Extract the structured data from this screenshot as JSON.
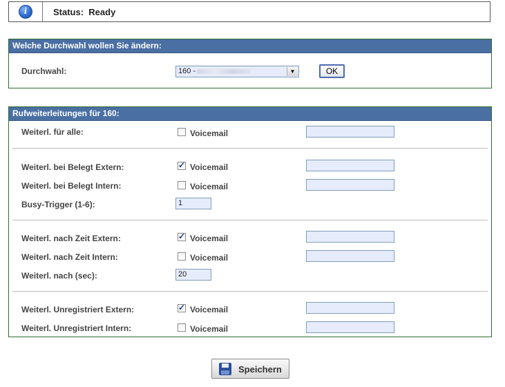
{
  "status": {
    "icon": "info-icon",
    "icon_glyph": "i",
    "label": "Status:",
    "value": "Ready"
  },
  "extension_panel": {
    "title": "Welche Durchwahl wollen Sie ändern:",
    "field_label": "Durchwahl:",
    "select_value": "160 -",
    "ok_label": "OK"
  },
  "forwarding_panel": {
    "title": "Rufweiterleitungen für 160:",
    "voicemail_label": "Voicemail",
    "rows": [
      {
        "label": "Weiterl. für alle:",
        "voicemail_checked": false,
        "target": ""
      },
      {
        "label": "Weiterl. bei Belegt Extern:",
        "voicemail_checked": true,
        "target": ""
      },
      {
        "label": "Weiterl. bei Belegt Intern:",
        "voicemail_checked": false,
        "target": ""
      },
      {
        "label": "Weiterl. nach Zeit Extern:",
        "voicemail_checked": true,
        "target": ""
      },
      {
        "label": "Weiterl. nach Zeit Intern:",
        "voicemail_checked": false,
        "target": ""
      },
      {
        "label": "Weiterl. Unregistriert Extern:",
        "voicemail_checked": true,
        "target": ""
      },
      {
        "label": "Weiterl. Unregistriert Intern:",
        "voicemail_checked": false,
        "target": ""
      }
    ],
    "busy_trigger": {
      "label": "Busy-Trigger (1-6):",
      "value": "1"
    },
    "delay": {
      "label": "Weiterl. nach (sec):",
      "value": "20"
    }
  },
  "save": {
    "icon": "floppy-disk-icon",
    "label": "Speichern"
  },
  "colors": {
    "panel_header": "#4a6fa3",
    "panel_border": "#2d6b2d",
    "input_bg": "#e6ecfb",
    "input_border": "#7f9db9"
  }
}
